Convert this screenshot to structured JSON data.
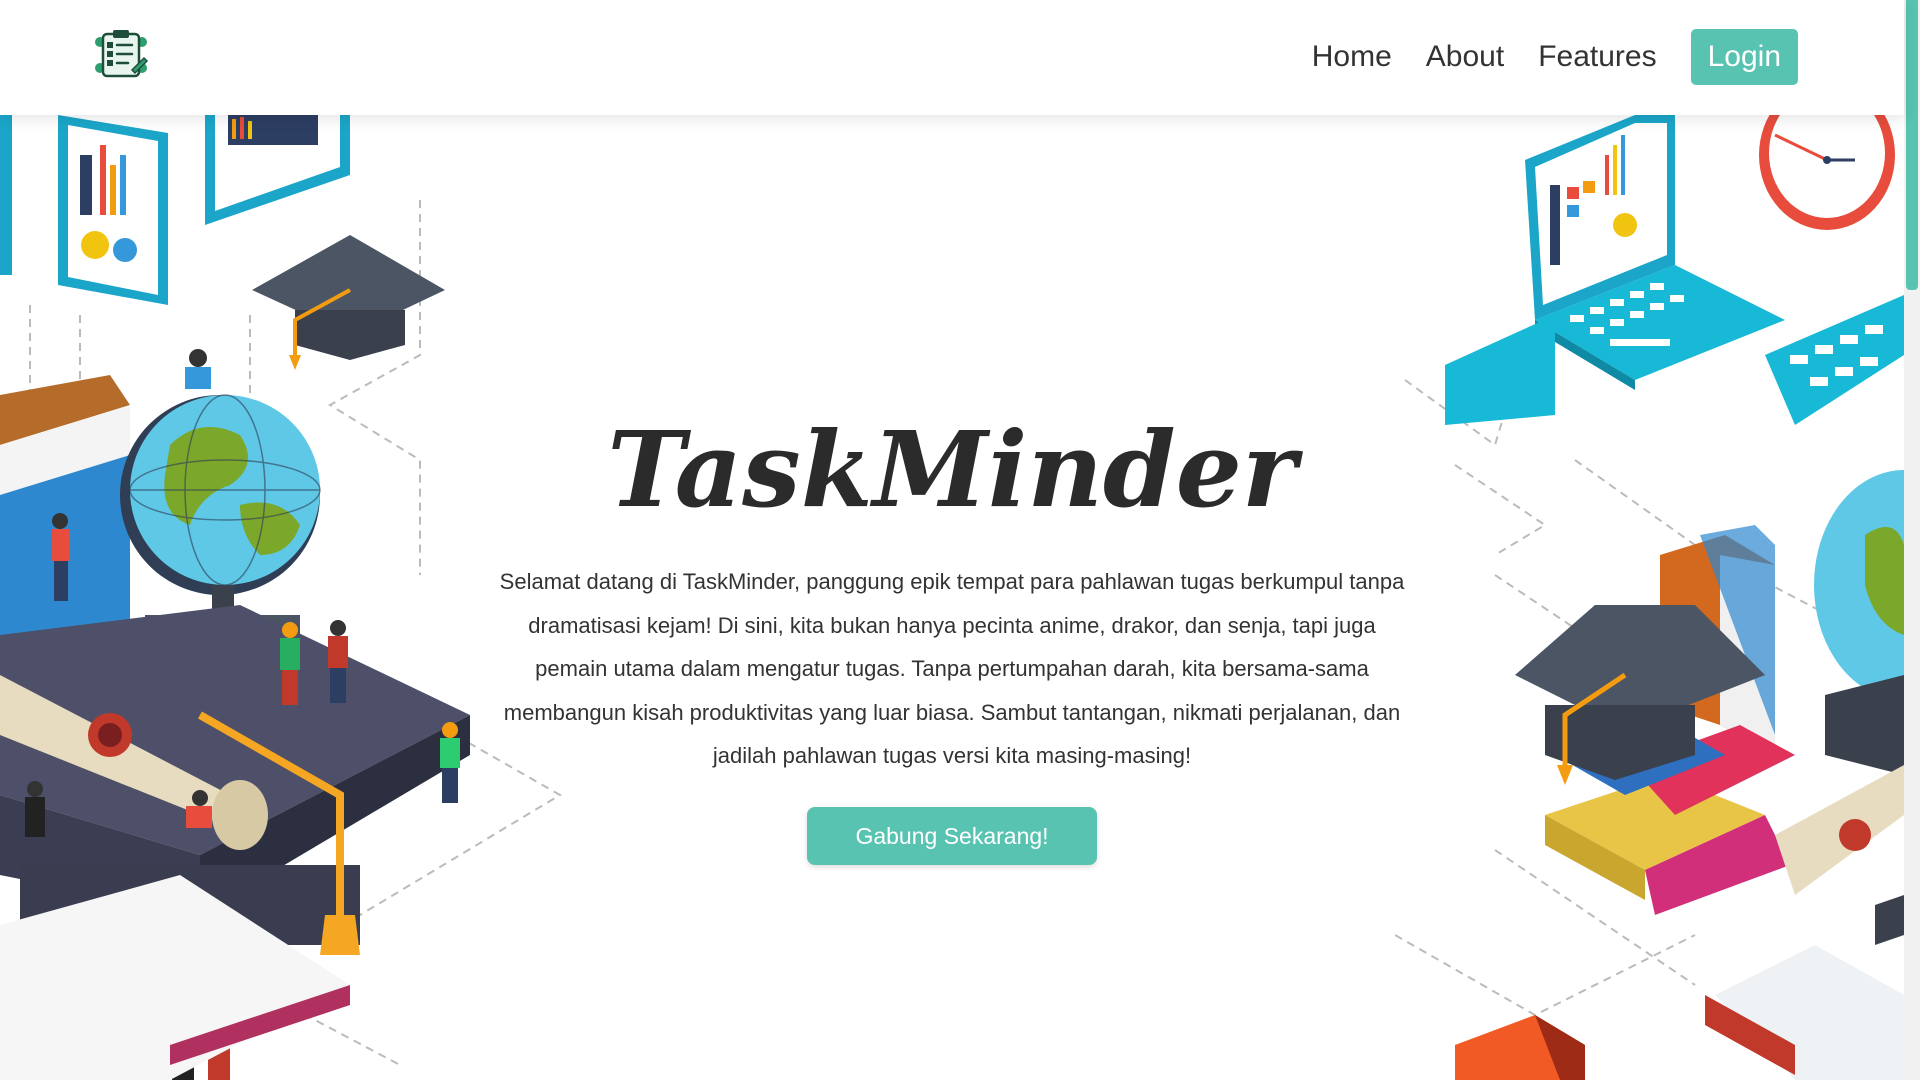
{
  "app": {
    "title": "TaskMinder"
  },
  "nav": {
    "items": [
      {
        "label": "Home"
      },
      {
        "label": "About"
      },
      {
        "label": "Features"
      }
    ],
    "login_label": "Login"
  },
  "hero": {
    "title": "TaskMinder",
    "description": "Selamat datang di TaskMinder, panggung epik tempat para pahlawan tugas berkumpul tanpa dramatisasi kejam! Di sini, kita bukan hanya pecinta anime, drakor, dan senja, tapi juga pemain utama dalam mengatur tugas. Tanpa pertumpahan darah, kita bersama-sama membangun kisah produktivitas yang luar biasa. Sambut tantangan, nikmati perjalanan, dan jadilah pahlawan tugas versi kita masing-masing!",
    "cta_label": "Gabung Sekarang!"
  },
  "colors": {
    "accent": "#58c3b1",
    "text": "#333333",
    "background": "#ffffff"
  },
  "icons": {
    "logo": "task-list-logo-icon"
  }
}
